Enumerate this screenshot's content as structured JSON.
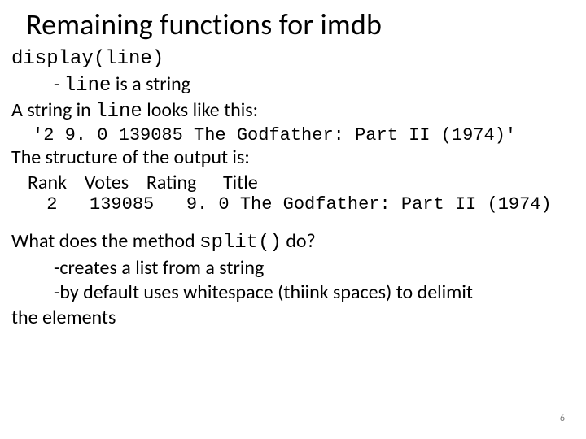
{
  "title": "Remaining functions for imdb",
  "l1_code": "display(line)",
  "l2_prefix": "- ",
  "l2_code": "line",
  "l2_suffix": " is a string",
  "l3_prefix": "A string in ",
  "l3_code": "line",
  "l3_suffix": " looks like this:",
  "sample": "'2 9. 0 139085 The Godfather: Part II (1974)'",
  "l4": "The structure of the output is:",
  "headers": "Rank    Votes    Rating      Title",
  "output_row": " 2   139085   9. 0 The Godfather: Part II (1974)",
  "q_prefix": "What does the method ",
  "q_code": "split()",
  "q_suffix": "  do?",
  "a1": "-creates a list from a string",
  "a2_part1": "-by default uses whitespace (thiink spaces)  to delimit",
  "a2_part2": "the elements",
  "page": "6"
}
